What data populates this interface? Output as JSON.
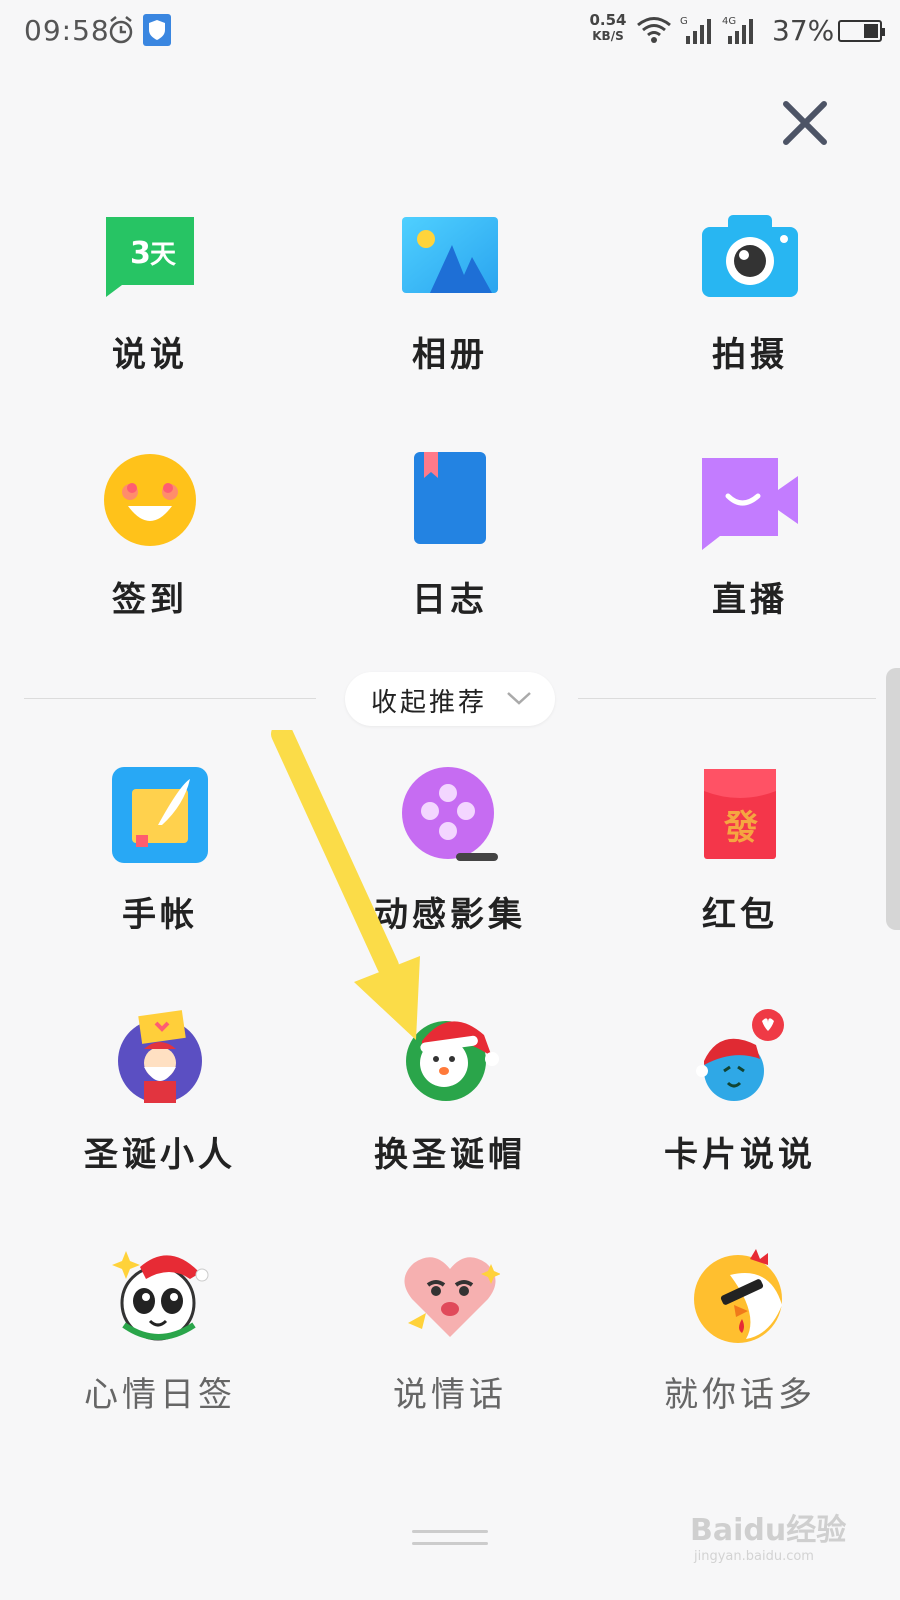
{
  "status_bar": {
    "time": "09:58",
    "net_speed": "0.54",
    "net_unit": "KB/S",
    "battery": "37%",
    "icons": [
      "alarm-icon",
      "shield-icon",
      "wifi-icon",
      "signal-icon",
      "signal-4g-icon",
      "battery-icon"
    ]
  },
  "close_icon": "close-icon",
  "main_items": [
    {
      "label": "说说",
      "icon": "3day-chat-icon"
    },
    {
      "label": "相册",
      "icon": "album-icon"
    },
    {
      "label": "拍摄",
      "icon": "camera-icon"
    },
    {
      "label": "签到",
      "icon": "smile-face-icon"
    },
    {
      "label": "日志",
      "icon": "blog-book-icon"
    },
    {
      "label": "直播",
      "icon": "live-video-icon"
    }
  ],
  "collapse_button": {
    "label": "收起推荐",
    "icon": "chevron-down-icon"
  },
  "recommend_items": [
    {
      "label": "手帐",
      "icon": "notebook-feather-icon"
    },
    {
      "label": "动感影集",
      "icon": "film-reel-icon"
    },
    {
      "label": "红包",
      "icon": "red-envelope-icon"
    },
    {
      "label": "圣诞小人",
      "icon": "santa-figure-icon"
    },
    {
      "label": "换圣诞帽",
      "icon": "christmas-hat-icon"
    },
    {
      "label": "卡片说说",
      "icon": "card-talk-icon"
    },
    {
      "label": "心情日签",
      "icon": "mood-panda-icon"
    },
    {
      "label": "说情话",
      "icon": "heart-face-icon"
    },
    {
      "label": "就你话多",
      "icon": "chatty-rooster-icon"
    }
  ],
  "watermark": {
    "brand": "Baidu经验",
    "url": "jingyan.baidu.com"
  },
  "colors": {
    "arrow": "#fbdc48",
    "background": "#f7f7f8"
  }
}
